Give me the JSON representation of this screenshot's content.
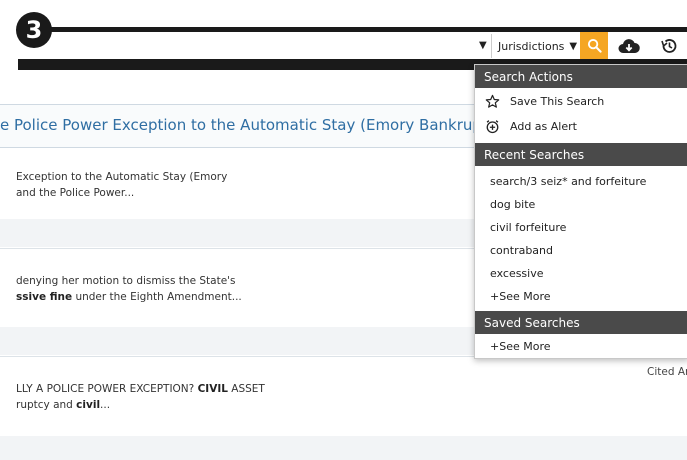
{
  "step_badge": "3",
  "toolbar": {
    "jurisdictions_label": "Jurisdictions",
    "icons": [
      "chevron-down-icon",
      "search-icon",
      "cloud-download-icon",
      "history-icon"
    ],
    "accent_color": "#f5a623"
  },
  "results": {
    "title": "e Police Power Exception to the Automatic Stay (Emory Bankruptcy Developm",
    "snippet1_line1": "Exception to the Automatic Stay (Emory",
    "snippet1_line2": "and the Police Power...",
    "snippet2_line1": "denying her motion to dismiss the State's",
    "snippet2_line2_bold": "ssive fine",
    "snippet2_line2_rest": " under the Eighth Amendment...",
    "snippet3_line1_a": "LLY A POLICE POWER EXCEPTION? ",
    "snippet3_line1_bold": "CIVIL",
    "snippet3_line1_b": " ASSET",
    "snippet3_line2_a": "ruptcy and ",
    "snippet3_line2_bold": "civil",
    "snippet3_line2_b": "...",
    "cited_label": "Cited Ar"
  },
  "dropdown": {
    "search_actions_header": "Search Actions",
    "save_search": "Save This Search",
    "add_alert": "Add as Alert",
    "recent_header": "Recent Searches",
    "recent": [
      "search/3 seiz* and forfeiture",
      "dog bite",
      "civil forfeiture",
      "contraband",
      "excessive"
    ],
    "recent_see_more": "+See More",
    "saved_header": "Saved Searches",
    "saved_see_more": "+See More"
  }
}
